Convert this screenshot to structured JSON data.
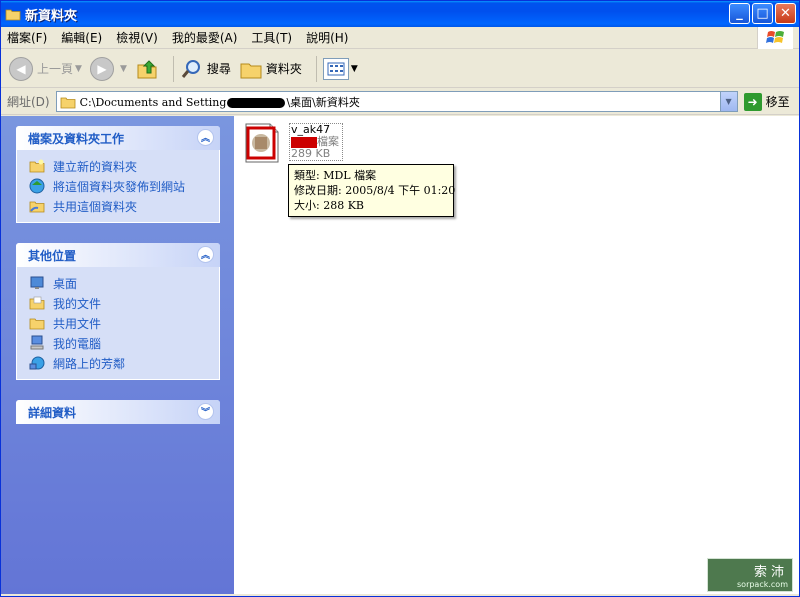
{
  "window": {
    "title": "新資料夾",
    "buttons": {
      "minimize": "_",
      "maximize": "□",
      "close": "✕"
    }
  },
  "menubar": {
    "items": [
      "檔案(F)",
      "編輯(E)",
      "檢視(V)",
      "我的最愛(A)",
      "工具(T)",
      "說明(H)"
    ]
  },
  "toolbar": {
    "back_label": "上一頁",
    "search_label": "搜尋",
    "folders_label": "資料夾"
  },
  "addressbar": {
    "label": "網址(D)",
    "path_prefix": "C:\\Documents and Setting",
    "path_suffix": "\\桌面\\新資料夾",
    "go_label": "移至"
  },
  "leftpane": {
    "tasks_panel": {
      "title": "檔案及資料夾工作",
      "items": [
        "建立新的資料夾",
        "將這個資料夾發佈到網站",
        "共用這個資料夾"
      ]
    },
    "places_panel": {
      "title": "其他位置",
      "items": [
        "桌面",
        "我的文件",
        "共用文件",
        "我的電腦",
        "網路上的芳鄰"
      ]
    },
    "details_panel": {
      "title": "詳細資料"
    }
  },
  "content": {
    "file": {
      "name": "v_ak47",
      "type_suffix": "檔案",
      "size": "289 KB"
    },
    "tooltip": {
      "type_line": "類型: MDL 檔案",
      "modified_line": "修改日期: 2005/8/4 下午 01:20",
      "size_line": "大小: 288 KB"
    }
  },
  "watermark": {
    "logo": "索沛",
    "url": "sorpack.com"
  },
  "colors": {
    "titlebar": "#0053ee",
    "panel_head_text": "#215dc6",
    "tooltip_bg": "#ffffe1"
  }
}
